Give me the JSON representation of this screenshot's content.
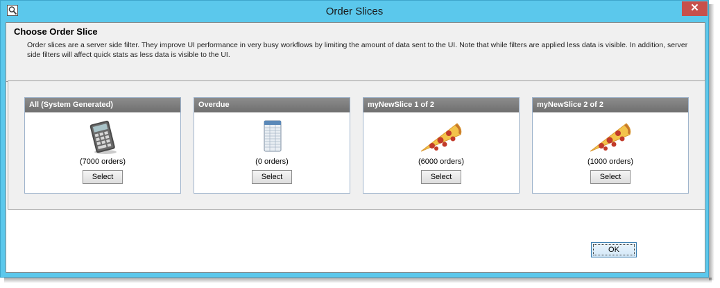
{
  "window": {
    "title": "Order Slices",
    "close_label": "✕"
  },
  "header": {
    "title": "Choose Order Slice",
    "description": "Order slices are a server side filter.  They improve UI performance in very busy workflows by limiting the amount of data sent to the UI.  Note that while filters are applied less data is visible.  In addition, server side filters will affect quick stats as less data is visible to the UI."
  },
  "slices": [
    {
      "title": "All (System Generated)",
      "count": "(7000 orders)",
      "select_label": "Select",
      "icon": "calculator-icon"
    },
    {
      "title": "Overdue",
      "count": "(0 orders)",
      "select_label": "Select",
      "icon": "spreadsheet-icon"
    },
    {
      "title": "myNewSlice 1 of 2",
      "count": "(6000 orders)",
      "select_label": "Select",
      "icon": "pizza-slice-icon"
    },
    {
      "title": "myNewSlice 2 of 2",
      "count": "(1000 orders)",
      "select_label": "Select",
      "icon": "pizza-slice-icon"
    }
  ],
  "footer": {
    "ok_label": "OK"
  },
  "colors": {
    "title_bar": "#5bc8ec",
    "close_button": "#c7504b",
    "card_header": "#7d7d7d"
  }
}
